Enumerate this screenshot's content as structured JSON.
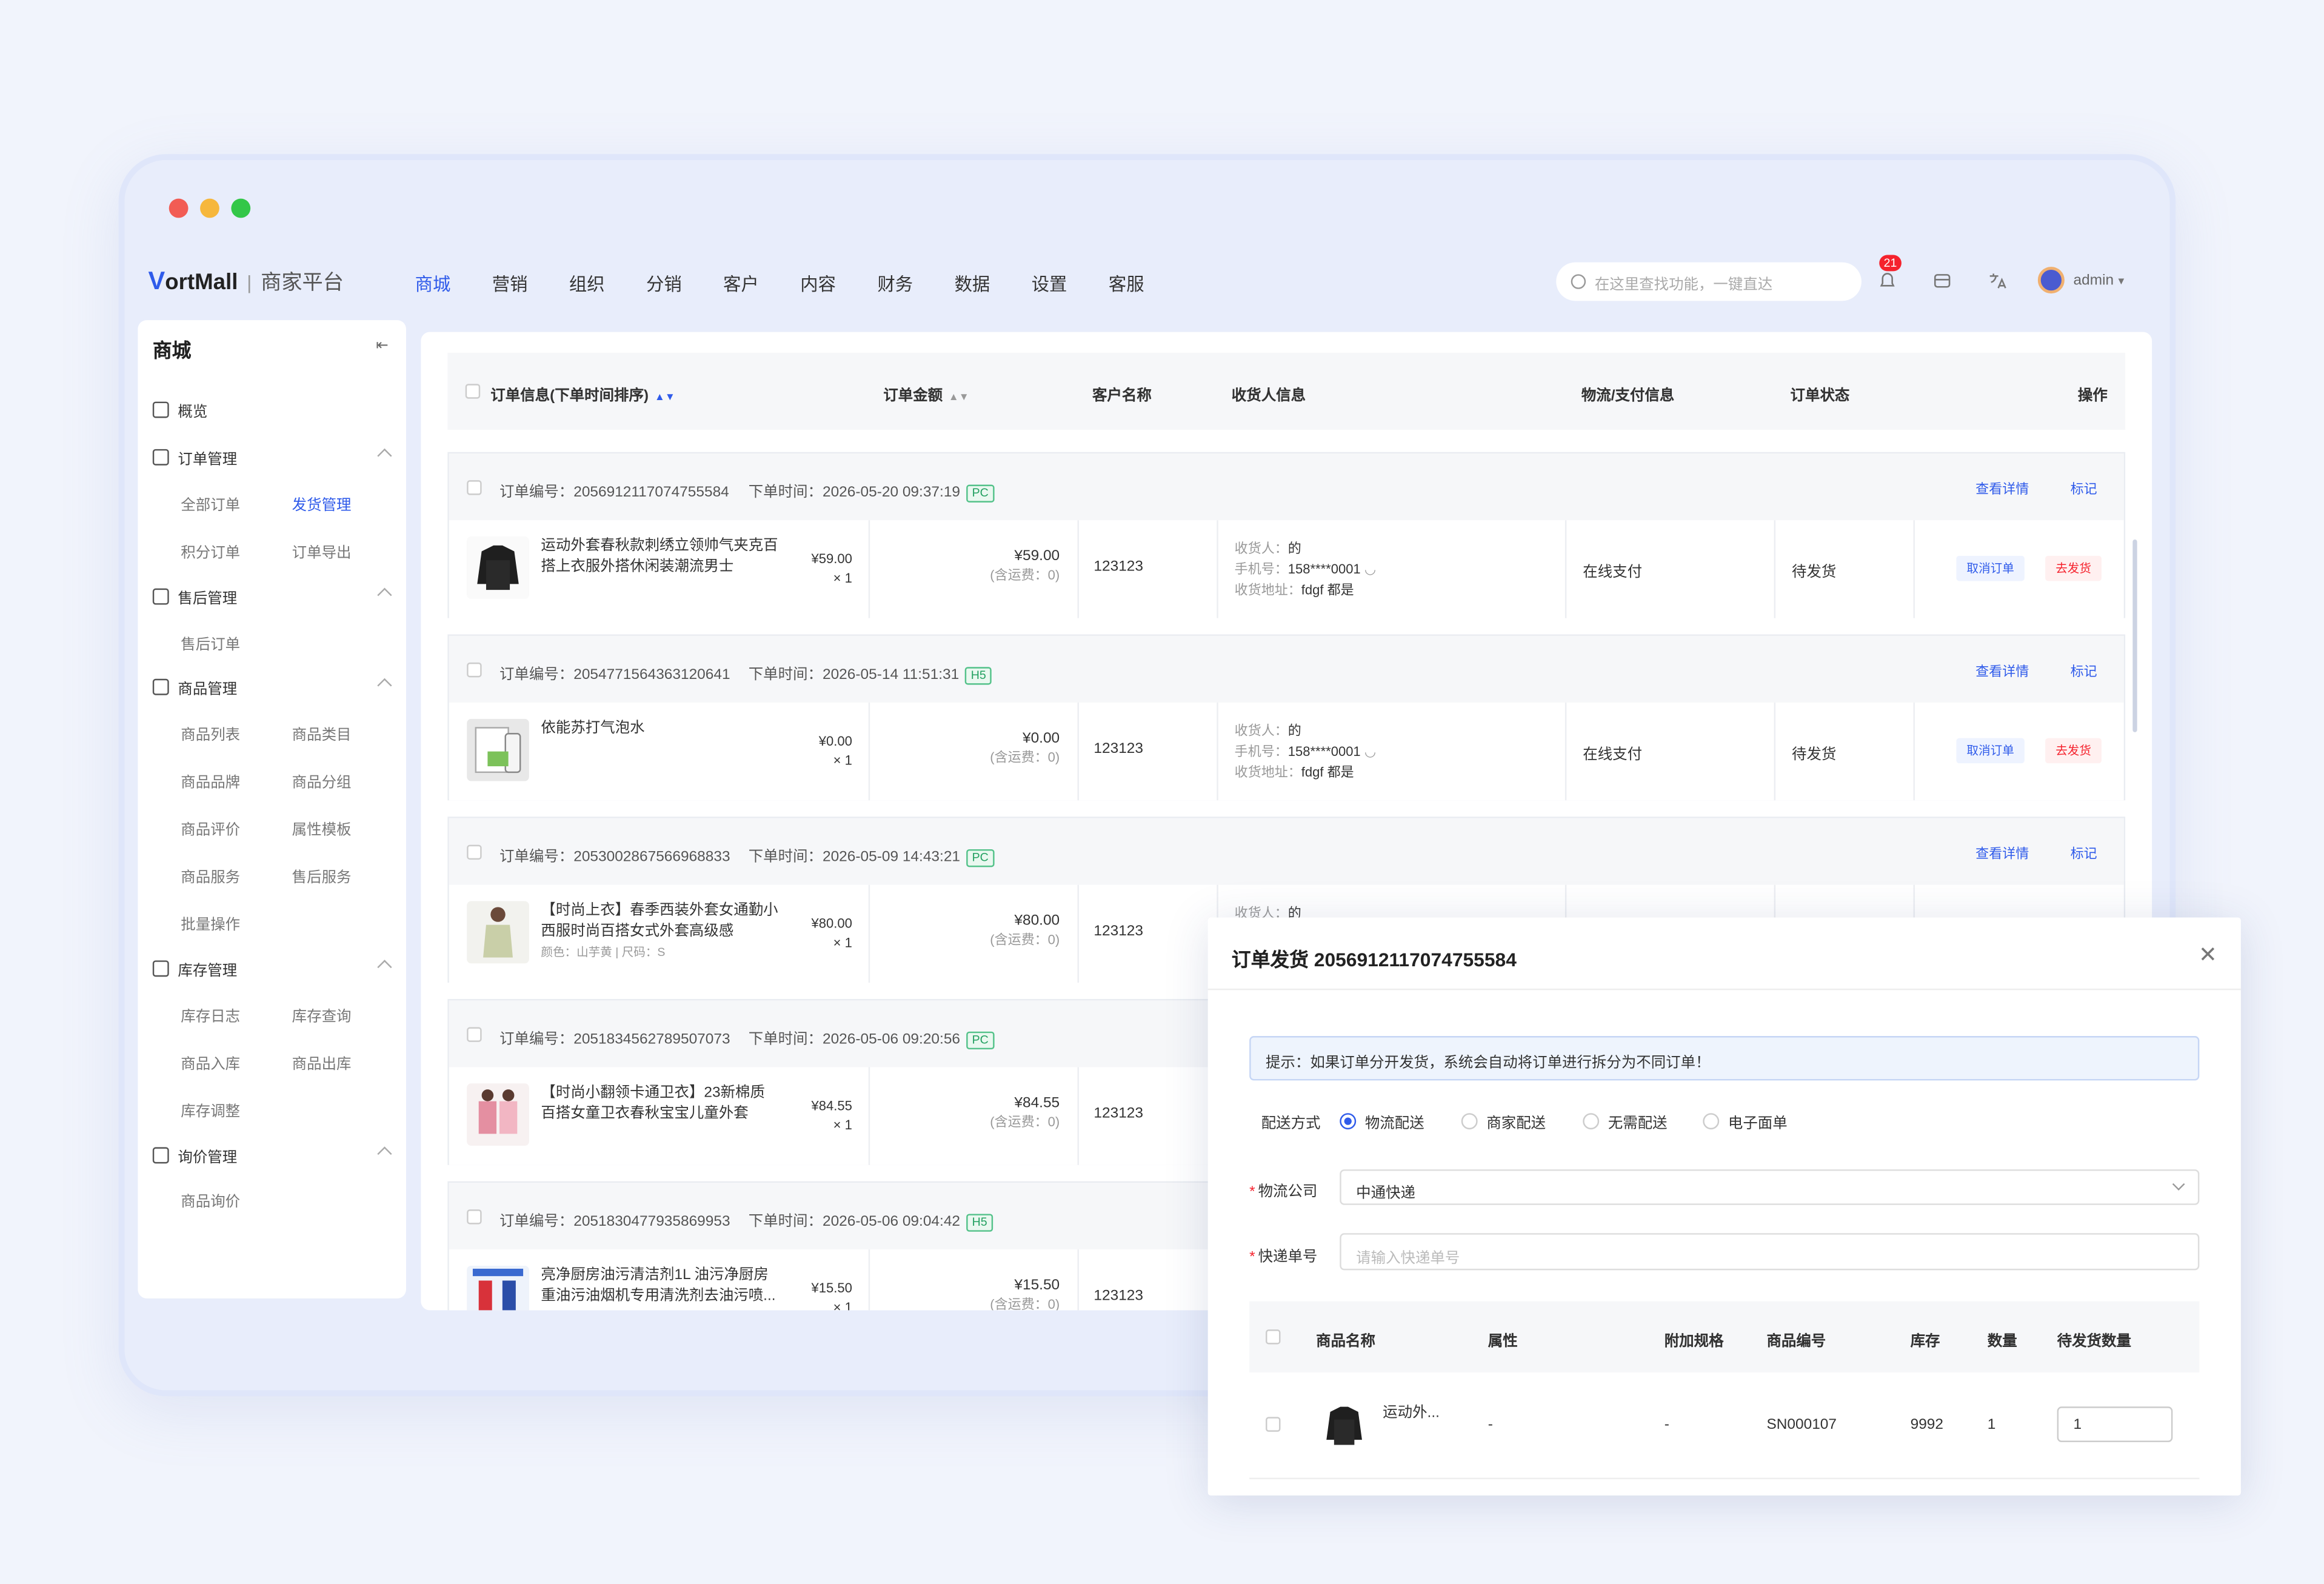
{
  "app": {
    "logo_mark": "V",
    "logo_text": "ortMall",
    "logo_sep": "|",
    "logo_sub": "商家平台"
  },
  "nav": [
    "商城",
    "营销",
    "组织",
    "分销",
    "客户",
    "内容",
    "财务",
    "数据",
    "设置",
    "客服"
  ],
  "search": {
    "placeholder": "在这里查找功能，一键直达"
  },
  "notifications": {
    "count": "21"
  },
  "user": {
    "name": "admin"
  },
  "sidebar": {
    "title": "商城",
    "overview": "概览",
    "groups": [
      {
        "label": "订单管理",
        "items": [
          "全部订单",
          "发货管理",
          "积分订单",
          "订单导出"
        ]
      },
      {
        "label": "售后管理",
        "items": [
          "售后订单"
        ]
      },
      {
        "label": "商品管理",
        "items": [
          "商品列表",
          "商品类目",
          "商品品牌",
          "商品分组",
          "商品评价",
          "属性模板",
          "商品服务",
          "售后服务",
          "批量操作"
        ]
      },
      {
        "label": "库存管理",
        "items": [
          "库存日志",
          "库存查询",
          "商品入库",
          "商品出库",
          "库存调整"
        ]
      },
      {
        "label": "询价管理",
        "items": [
          "商品询价"
        ]
      }
    ]
  },
  "table": {
    "headers": [
      "订单信息(下单时间排序)",
      "订单金额",
      "客户名称",
      "收货人信息",
      "物流/支付信息",
      "订单状态",
      "操作"
    ]
  },
  "labels": {
    "order_no": "订单编号：",
    "order_time": "下单时间：",
    "view_detail": "查看详情",
    "mark": "标记",
    "fee": "(含运费：0)",
    "receiver": "收货人：",
    "phone": "手机号：",
    "address": "收货地址：",
    "cancel": "取消订单",
    "ship": "去发货"
  },
  "orders": [
    {
      "no": "2056912117074755584",
      "time": "2026-05-20 09:37:19",
      "channel": "PC",
      "product": "运动外套春秋款刺绣立领帅气夹克百搭上衣服外搭休闲装潮流男士",
      "attr": "",
      "unit_price": "¥59.00",
      "qty": "× 1",
      "amount": "¥59.00",
      "customer": "123123",
      "receiver": "的",
      "phone": "158****0001",
      "address": "fdgf 都是",
      "pay": "在线支付",
      "status": "待发货"
    },
    {
      "no": "2054771564363120641",
      "time": "2026-05-14 11:51:31",
      "channel": "H5",
      "product": "依能苏打气泡水",
      "attr": "",
      "unit_price": "¥0.00",
      "qty": "× 1",
      "amount": "¥0.00",
      "customer": "123123",
      "receiver": "的",
      "phone": "158****0001",
      "address": "fdgf 都是",
      "pay": "在线支付",
      "status": "待发货"
    },
    {
      "no": "2053002867566968833",
      "time": "2026-05-09 14:43:21",
      "channel": "PC",
      "product": "【时尚上衣】春季西装外套女通勤小西服时尚百搭女式外套高级感",
      "attr": "颜色：山芋黄 | 尺码：S",
      "unit_price": "¥80.00",
      "qty": "× 1",
      "amount": "¥80.00",
      "customer": "123123",
      "receiver": "的",
      "phone": "",
      "address": "",
      "pay": "",
      "status": ""
    },
    {
      "no": "2051834562789507073",
      "time": "2026-05-06 09:20:56",
      "channel": "PC",
      "product": "【时尚小翻领卡通卫衣】23新棉质百搭女童卫衣春秋宝宝儿童外套",
      "attr": "",
      "unit_price": "¥84.55",
      "qty": "× 1",
      "amount": "¥84.55",
      "customer": "123123",
      "receiver": "",
      "phone": "",
      "address": "",
      "pay": "",
      "status": ""
    },
    {
      "no": "2051830477935869953",
      "time": "2026-05-06 09:04:42",
      "channel": "H5",
      "product": "亮净厨房油污清洁剂1L 油污净厨房重油污油烟机专用清洗剂去油污喷...",
      "attr": "",
      "unit_price": "¥15.50",
      "qty": "× 1",
      "amount": "¥15.50",
      "customer": "123123",
      "receiver": "",
      "phone": "",
      "address": "",
      "pay": "",
      "status": ""
    }
  ],
  "modal": {
    "title": "订单发货 2056912117074755584",
    "tip": "提示：如果订单分开发货，系统会自动将订单进行拆分为不同订单！",
    "delivery_label": "配送方式",
    "delivery_options": [
      "物流配送",
      "商家配送",
      "无需配送",
      "电子面单"
    ],
    "delivery_selected": "物流配送",
    "company_label": "物流公司",
    "company_value": "中通快递",
    "tracking_label": "快递单号",
    "tracking_placeholder": "请输入快递单号",
    "table_headers": [
      "商品名称",
      "属性",
      "附加规格",
      "商品编号",
      "库存",
      "数量",
      "待发货数量"
    ],
    "row": {
      "name": "运动外...",
      "attr": "-",
      "extra": "-",
      "sku": "SN000107",
      "stock": "9992",
      "qty": "1",
      "ship_qty": "1"
    }
  },
  "colors": {
    "accent": "#2f5bea",
    "danger": "#f5222d",
    "window_bg": "#e8edfb"
  }
}
